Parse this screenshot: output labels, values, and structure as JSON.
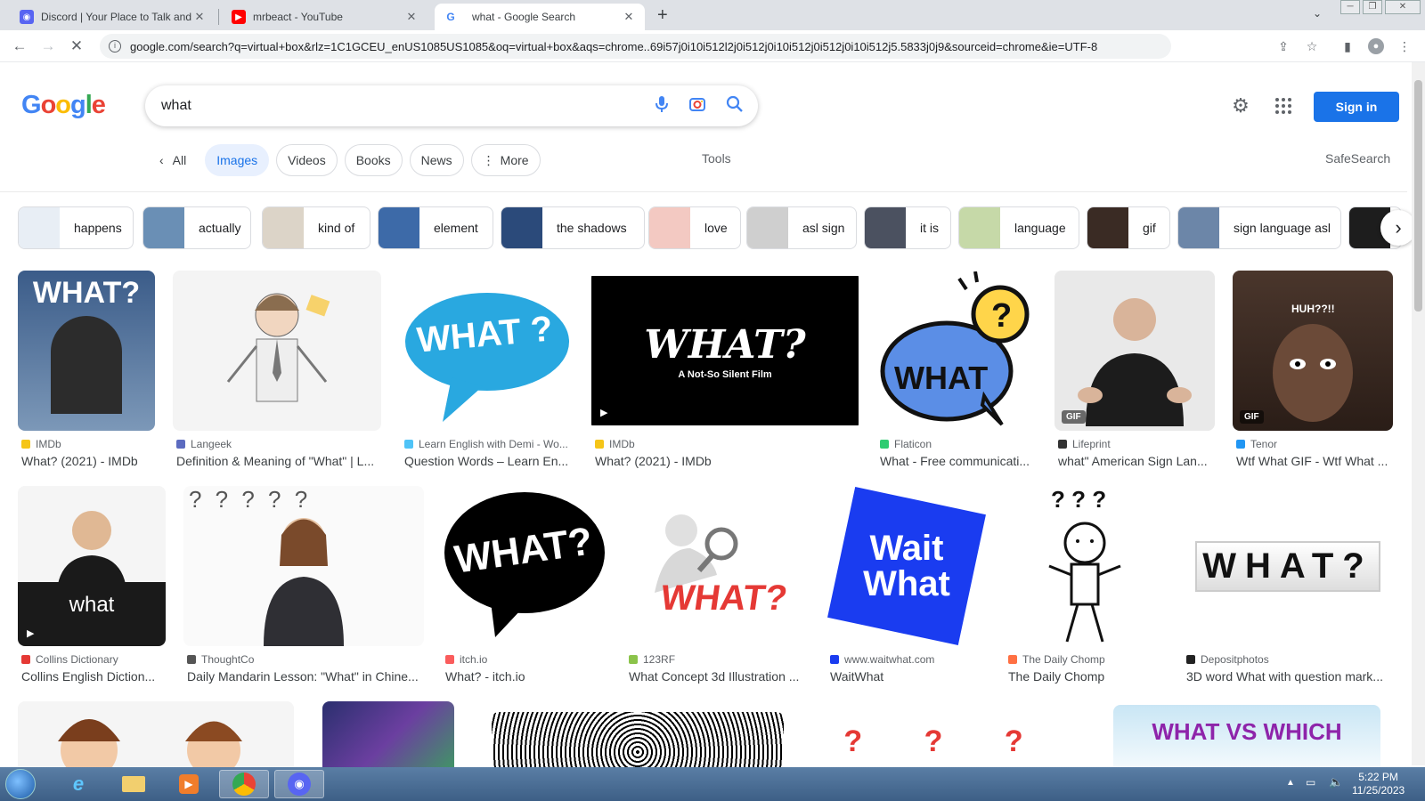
{
  "browser": {
    "tabs": [
      {
        "title": "Discord | Your Place to Talk and H",
        "favicon": "discord-icon",
        "color": "#5865f2"
      },
      {
        "title": "mrbeact - YouTube",
        "favicon": "youtube-icon",
        "color": "#ff0000"
      },
      {
        "title": "what - Google Search",
        "favicon": "google-icon",
        "color": "#4285f4"
      }
    ],
    "url": "google.com/search?q=virtual+box&rlz=1C1GCEU_enUS1085US1085&oq=virtual+box&aqs=chrome..69i57j0i10i512l2j0i512j0i10i512j0i512j0i10i512j5.5833j0j9&sourceid=chrome&ie=UTF-8"
  },
  "google": {
    "logo_letters": [
      "G",
      "o",
      "o",
      "g",
      "l",
      "e"
    ],
    "query": "what",
    "sign_in": "Sign in",
    "filters": {
      "back_all": "All",
      "images": "Images",
      "videos": "Videos",
      "books": "Books",
      "news": "News",
      "more": "More"
    },
    "tools": "Tools",
    "safesearch": "SafeSearch"
  },
  "related": [
    {
      "label": "happens",
      "color": "#e8eef5"
    },
    {
      "label": "actually",
      "color": "#6a8fb5"
    },
    {
      "label": "kind of",
      "color": "#dcd4c8"
    },
    {
      "label": "element",
      "color": "#3d6aa8"
    },
    {
      "label": "the shadows",
      "color": "#2b4a7a"
    },
    {
      "label": "love",
      "color": "#f3c9c2"
    },
    {
      "label": "asl sign",
      "color": "#cfcfcf"
    },
    {
      "label": "it is",
      "color": "#4b5160"
    },
    {
      "label": "language",
      "color": "#c6d9a8"
    },
    {
      "label": "gif",
      "color": "#3a2b24"
    },
    {
      "label": "sign language asl",
      "color": "#6c86a8"
    },
    {
      "label": "",
      "color": "#1d1d1d"
    }
  ],
  "results_row1": [
    {
      "source": "IMDb",
      "title": "What? (2021) - IMDb",
      "src_color": "#f5c518",
      "bg": "#3b5c89",
      "art_text": "WHAT?"
    },
    {
      "source": "Langeek",
      "title": "Definition & Meaning of \"What\" | L...",
      "src_color": "#5c6bc0",
      "bg": "#f4f4f4",
      "art_text": ""
    },
    {
      "source": "Learn English with Demi - Wo...",
      "title": "Question Words – Learn En...",
      "src_color": "#4fc3f7",
      "bg": "#ffffff",
      "art_text": "WHAT ?"
    },
    {
      "source": "IMDb",
      "title": "What? (2021) - IMDb",
      "src_color": "#f5c518",
      "bg": "#000000",
      "art_text": "WHAT?",
      "art_sub": "A Not-So Silent Film"
    },
    {
      "source": "Flaticon",
      "title": "What - Free communicati...",
      "src_color": "#2ecc71",
      "bg": "#ffffff",
      "art_text": "WHAT"
    },
    {
      "source": "Lifeprint",
      "title": "what\" American Sign Lan...",
      "src_color": "#333333",
      "bg": "#e9e9e9",
      "badge": "GIF"
    },
    {
      "source": "Tenor",
      "title": "Wtf What GIF - Wtf What ...",
      "src_color": "#2196f3",
      "bg": "#3a2b24",
      "art_text": "HUH??!!",
      "badge": "GIF"
    }
  ],
  "results_row2": [
    {
      "source": "Collins Dictionary",
      "title": "Collins English Diction...",
      "src_color": "#e53935",
      "bg": "#f5f5f5",
      "art_text": "what"
    },
    {
      "source": "ThoughtCo",
      "title": "Daily Mandarin Lesson: \"What\" in Chine...",
      "src_color": "#555555",
      "bg": "#fafafa",
      "art_text": "? ? ? ? ?"
    },
    {
      "source": "itch.io",
      "title": "What? - itch.io",
      "src_color": "#fa5c5c",
      "bg": "#ffffff",
      "art_text": "WHAT?"
    },
    {
      "source": "123RF",
      "title": "What Concept 3d Illustration ...",
      "src_color": "#8bc34a",
      "bg": "#ffffff",
      "art_text": "WHAT?"
    },
    {
      "source": "www.waitwhat.com",
      "title": "WaitWhat",
      "src_color": "#1a3cf0",
      "bg": "#ffffff",
      "art_text": "Wait What"
    },
    {
      "source": "The Daily Chomp",
      "title": "The Daily Chomp",
      "src_color": "#ff7043",
      "bg": "#ffffff",
      "art_text": "? ? ?"
    },
    {
      "source": "Depositphotos",
      "title": "3D word What with question mark...",
      "src_color": "#222222",
      "bg": "#ffffff",
      "art_text": "WHAT?"
    }
  ],
  "row3_art": [
    "",
    "",
    "",
    "? ? ?",
    "WHAT VS WHICH"
  ],
  "taskbar": {
    "time": "5:22 PM",
    "date": "11/25/2023"
  }
}
